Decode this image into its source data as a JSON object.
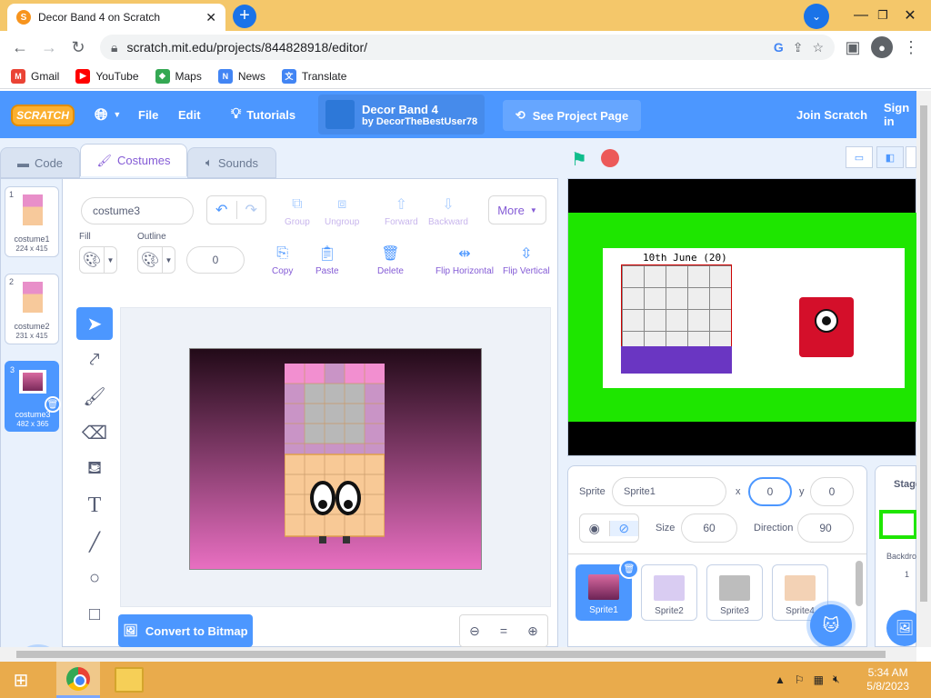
{
  "browser": {
    "tab_title": "Decor Band 4 on Scratch",
    "url": "scratch.mit.edu/projects/844828918/editor/",
    "bookmarks": [
      "Gmail",
      "YouTube",
      "Maps",
      "News",
      "Translate"
    ]
  },
  "menubar": {
    "logo": "SCRATCH",
    "file": "File",
    "edit": "Edit",
    "tutorials": "Tutorials",
    "project_title": "Decor Band 4",
    "project_author": "by DecorTheBestUser78",
    "see_project_page": "See Project Page",
    "join": "Join Scratch",
    "sign_in": "Sign in"
  },
  "tabs": {
    "code": "Code",
    "costumes": "Costumes",
    "sounds": "Sounds"
  },
  "costumes": [
    {
      "num": "1",
      "name": "costume1",
      "size": "224 x 415"
    },
    {
      "num": "2",
      "name": "costume2",
      "size": "231 x 415"
    },
    {
      "num": "3",
      "name": "costume3",
      "size": "482 x 365"
    }
  ],
  "paint": {
    "costume_name": "costume3",
    "group": "Group",
    "ungroup": "Ungroup",
    "forward": "Forward",
    "backward": "Backward",
    "more": "More",
    "fill_label": "Fill",
    "outline_label": "Outline",
    "outline_width": "0",
    "copy": "Copy",
    "paste": "Paste",
    "delete": "Delete",
    "flip_h": "Flip Horizontal",
    "flip_v": "Flip Vertical",
    "convert": "Convert to Bitmap"
  },
  "stage": {
    "caption": "10th June (20)"
  },
  "sprite_info": {
    "sprite_label": "Sprite",
    "sprite_name": "Sprite1",
    "x_label": "x",
    "x_value": "0",
    "y_label": "y",
    "y_value": "0",
    "size_label": "Size",
    "size_value": "60",
    "direction_label": "Direction",
    "direction_value": "90"
  },
  "sprites": [
    "Sprite1",
    "Sprite2",
    "Sprite3",
    "Sprite4"
  ],
  "stage_panel": {
    "title": "Stage",
    "backdrops_label": "Backdrops",
    "backdrops_count": "1"
  },
  "taskbar": {
    "time": "5:34 AM",
    "date": "5/8/2023"
  },
  "colors": {
    "scratch_blue": "#4c97ff",
    "stage_green": "#1ee600",
    "tabbar": "#f4c76a",
    "taskbar": "#e9ab4c"
  }
}
